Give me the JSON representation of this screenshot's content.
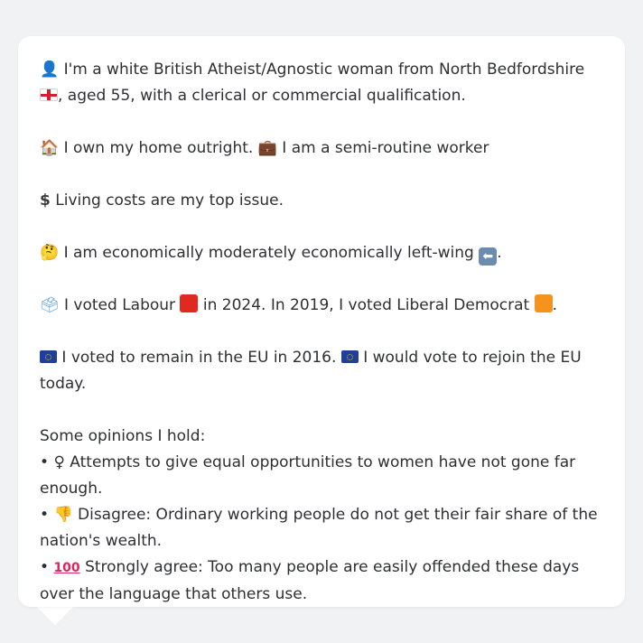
{
  "profile": {
    "intro": "I'm a white British Atheist/Agnostic woman from North Bedfordshire",
    "intro_tail": ", aged 55, with a clerical or commercial qualification.",
    "home": "I own my home outright.",
    "work": "I am a semi-routine worker",
    "issue": "Living costs are my top issue.",
    "economic": "I am economically moderately economically left-wing",
    "economic_tail": ".",
    "vote_2024_pre": "I voted Labour",
    "vote_2024_post": "in 2024. In 2019, I voted Liberal Democrat",
    "vote_2019_tail": ".",
    "eu_2016": "I voted to remain in the EU in 2016.",
    "eu_today": "I would vote to rejoin the EU today."
  },
  "opinions": {
    "heading": "Some opinions I hold:",
    "items": [
      {
        "bullet": "•",
        "icon": "♀",
        "text": " Attempts to give equal opportunities to women have not gone far enough."
      },
      {
        "bullet": "•",
        "icon": "👎",
        "text": "Disagree: Ordinary working people do not get their fair share of the nation's wealth."
      },
      {
        "bullet": "•",
        "icon": "💯",
        "text": "Strongly agree: Too many people are easily offended these days over the language that others use."
      }
    ]
  },
  "icons": {
    "person": "👤",
    "house": "🏠",
    "briefcase": "💼",
    "dollar": "$",
    "thinking": "🤔",
    "ballot": "🗳",
    "left_arrow": "⬅",
    "hundred": "100"
  },
  "colors": {
    "labour": "#e02a20",
    "libdem": "#f5931f",
    "eu_blue": "#1f3f9a"
  }
}
